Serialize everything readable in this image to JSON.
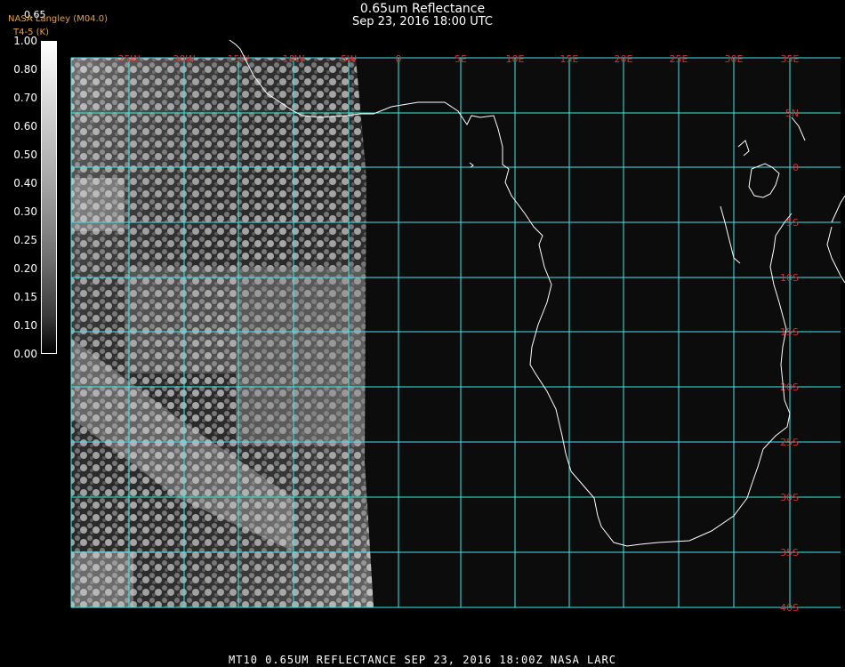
{
  "header": {
    "title": "0.65um Reflectance",
    "subtitle": "Sep 23, 2016 18:00 UTC",
    "credit": "NASA Langley (M04.0)",
    "credit_sub": "T4-5 (K)",
    "band": "0.65"
  },
  "colorbar": {
    "ticks": [
      "1.00",
      "0.80",
      "0.70",
      "0.60",
      "0.50",
      "0.40",
      "0.30",
      "0.25",
      "0.20",
      "0.15",
      "0.10",
      "0.00"
    ]
  },
  "map": {
    "lon_labels": [
      "25W",
      "20W",
      "15W",
      "10W",
      "5W",
      "0",
      "5E",
      "10E",
      "15E",
      "20E",
      "25E",
      "30E",
      "35E"
    ],
    "lat_labels": [
      "5N",
      "0",
      "5S",
      "10S",
      "15S",
      "20S",
      "25S",
      "30S",
      "35S",
      "40S"
    ],
    "grid_color": "#3fe8e8",
    "label_color": "#d23030",
    "coast_color": "#ffffff"
  },
  "footer": {
    "caption": "MT10   0.65UM REFLECTANCE   SEP 23, 2016 18:00Z   NASA LARC"
  }
}
